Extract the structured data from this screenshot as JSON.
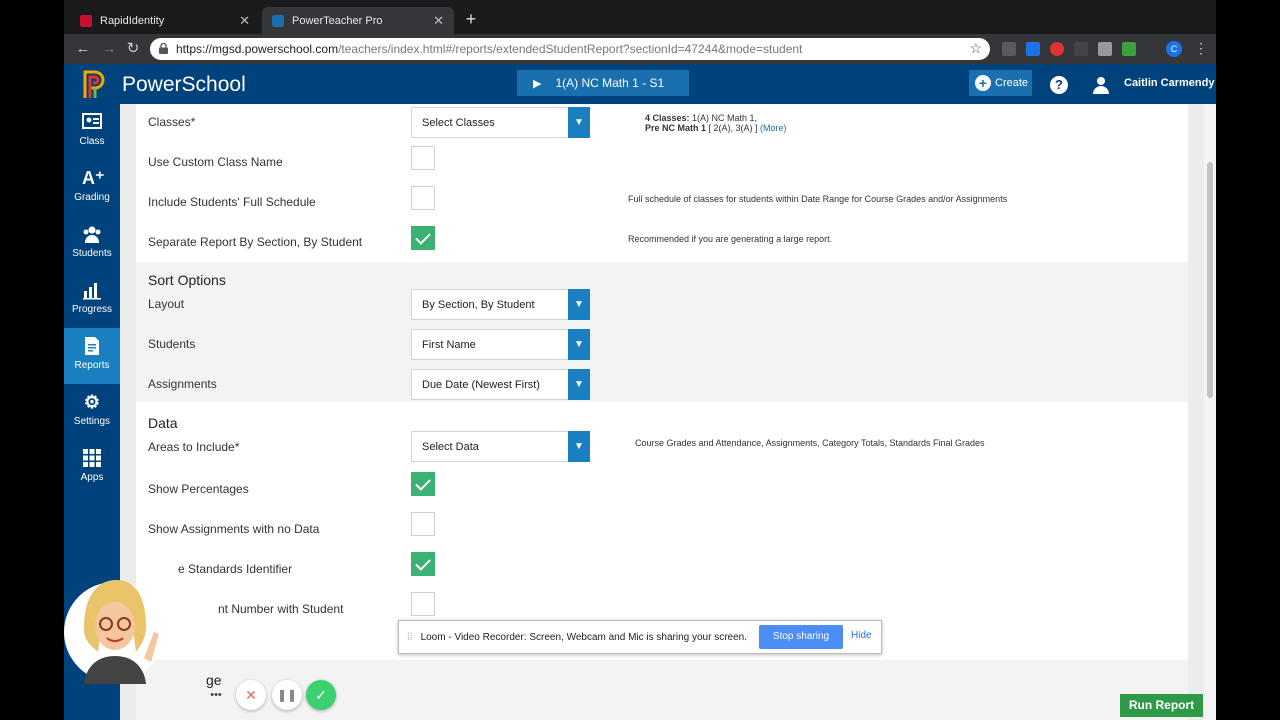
{
  "browser": {
    "tabs": [
      {
        "title": "RapidIdentity",
        "favicon_color": "#c8102e"
      },
      {
        "title": "PowerTeacher Pro",
        "favicon_color": "#1a6fae"
      }
    ],
    "url_host": "https://mgsd.powerschool.com",
    "url_path": "/teachers/index.html#/reports/extendedStudentReport?sectionId=47244&mode=student",
    "profile_initial": "C"
  },
  "header": {
    "brand": "PowerSchool",
    "class_selector": "1(A) NC Math 1  -  S1",
    "create_label": "Create",
    "help_label": "?",
    "user_name": "Caitlin Carmendy"
  },
  "sidebar": {
    "items": [
      {
        "label": "Class",
        "icon": "class-icon",
        "active": false
      },
      {
        "label": "Grading",
        "icon": "grading-icon",
        "active": false
      },
      {
        "label": "Students",
        "icon": "students-icon",
        "active": false
      },
      {
        "label": "Progress",
        "icon": "progress-icon",
        "active": false
      },
      {
        "label": "Reports",
        "icon": "reports-icon",
        "active": true
      },
      {
        "label": "Settings",
        "icon": "settings-icon",
        "active": false
      },
      {
        "label": "Apps",
        "icon": "apps-icon",
        "active": false
      }
    ]
  },
  "form": {
    "classes_label": "Classes*",
    "classes_value": "Select Classes",
    "classes_hint_bold": "4 Classes:",
    "classes_hint_1": " 1(A) NC Math 1,",
    "classes_hint_2_bold": "Pre NC Math 1",
    "classes_hint_2": " [ 2(A), 3(A) ]",
    "classes_hint_more": " (More)",
    "custom_name_label": "Use Custom Class Name",
    "full_schedule_label": "Include Students' Full Schedule",
    "full_schedule_hint": "Full schedule of classes for students within Date Range for Course Grades and/or Assignments",
    "separate_label": "Separate Report By Section, By Student",
    "separate_hint": "Recommended if you are generating a large report.",
    "sort_title": "Sort Options",
    "layout_label": "Layout",
    "layout_value": "By Section, By Student",
    "students_label": "Students",
    "students_value": "First Name",
    "assignments_label": "Assignments",
    "assignments_value": "Due Date (Newest First)",
    "data_title": "Data",
    "areas_label": "Areas to Include*",
    "areas_value": "Select Data",
    "areas_hint": "Course Grades and Attendance, Assignments, Category Totals, Standards Final Grades",
    "percentages_label": "Show Percentages",
    "no_data_label": "Show Assignments with no Data",
    "standards_id_label": "e Standards Identifier",
    "student_number_label": "nt Number with Student",
    "partial_section": "ge"
  },
  "loom": {
    "message": "Loom - Video Recorder: Screen, Webcam and Mic is sharing your screen.",
    "stop_label": "Stop sharing",
    "hide_label": "Hide"
  },
  "footer": {
    "run_report_label": "Run Report"
  }
}
